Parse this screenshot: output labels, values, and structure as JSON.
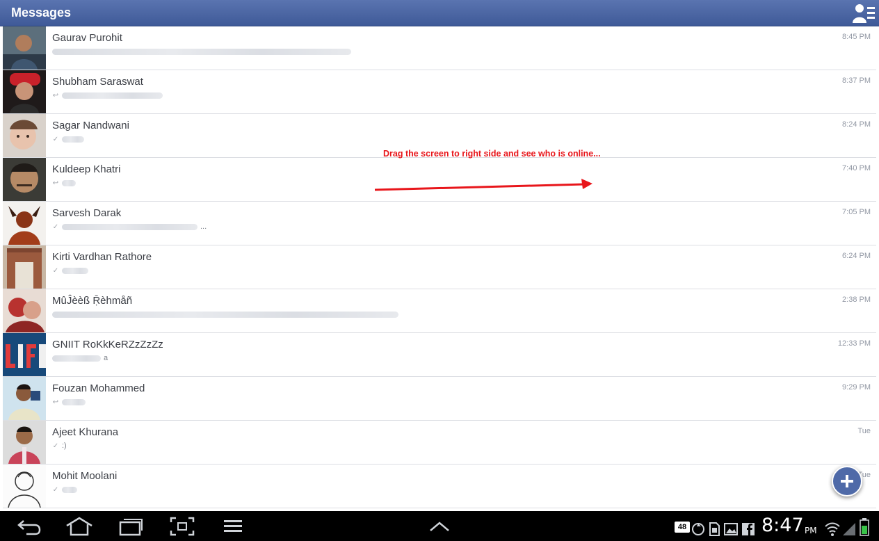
{
  "header": {
    "title": "Messages",
    "friends_icon": "friend-list-icon"
  },
  "annotation": {
    "text": "Drag the screen to right side and see who is online..."
  },
  "conversations": [
    {
      "name": "Gaurav Purohit",
      "time": "8:45 PM",
      "status": "none",
      "snippet_visible": ""
    },
    {
      "name": "Shubham Saraswat",
      "time": "8:37 PM",
      "status": "replied",
      "snippet_visible": ""
    },
    {
      "name": "Sagar Nandwani",
      "time": "8:24 PM",
      "status": "seen",
      "snippet_visible": ""
    },
    {
      "name": "Kuldeep Khatri",
      "time": "7:40 PM",
      "status": "replied",
      "snippet_visible": ""
    },
    {
      "name": "Sarvesh Darak",
      "time": "7:05 PM",
      "status": "seen",
      "snippet_visible": "..."
    },
    {
      "name": "Kirti Vardhan Rathore",
      "time": "6:24 PM",
      "status": "seen",
      "snippet_visible": ""
    },
    {
      "name": "MûĴèèß Ṝèhmåñ",
      "time": "2:38 PM",
      "status": "none",
      "snippet_visible": ""
    },
    {
      "name": "GNIIT RoKkKeRZzZzZz",
      "time": "12:33 PM",
      "status": "none",
      "snippet_visible": "a"
    },
    {
      "name": "Fouzan Mohammed",
      "time": "9:29 PM",
      "status": "replied",
      "snippet_visible": ""
    },
    {
      "name": "Ajeet Khurana",
      "time": "Tue",
      "status": "seen",
      "snippet_visible": ":)"
    },
    {
      "name": "Mohit Moolani",
      "time": "Tue",
      "status": "seen",
      "snippet_visible": ""
    }
  ],
  "fab": {
    "icon": "plus-icon"
  },
  "system_bar": {
    "clock": "8:47",
    "ampm": "PM",
    "nav": [
      "back-icon",
      "home-icon",
      "recent-apps-icon",
      "screenshot-icon",
      "menu-icon",
      "chevron-up-icon"
    ],
    "notification_badge": "48",
    "accent": "#000000"
  },
  "colors": {
    "header": "#4c66a4",
    "annotation": "#e8161b",
    "fab": "#4f6aa8"
  }
}
